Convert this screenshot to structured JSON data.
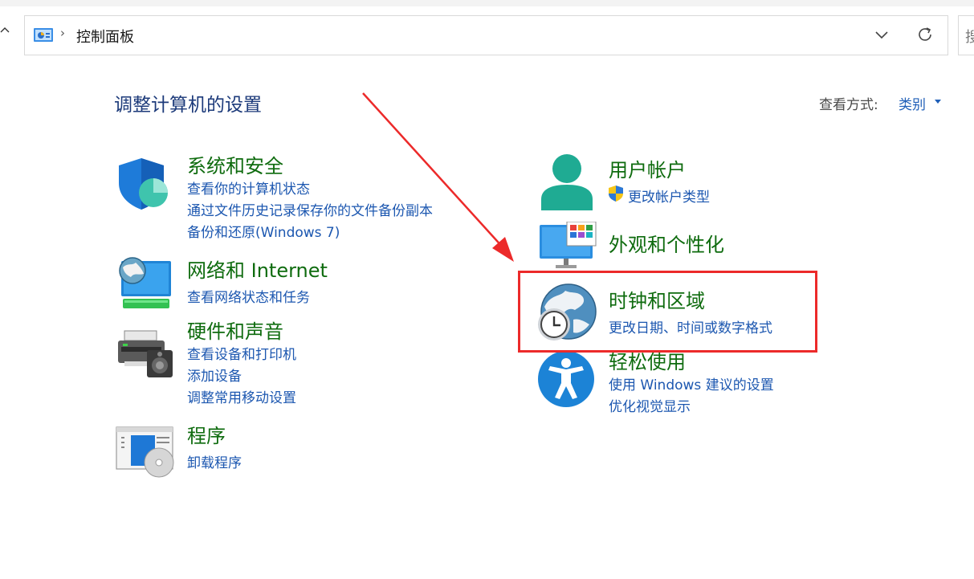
{
  "address_bar": {
    "path_text": "控制面板",
    "search_placeholder": "搜"
  },
  "page": {
    "title": "调整计算机的设置",
    "view_by_label": "查看方式:",
    "view_by_value": "类别"
  },
  "categories_left": [
    {
      "title": "系统和安全",
      "icon": "shield-icon",
      "links": [
        "查看你的计算机状态",
        "通过文件历史记录保存你的文件备份副本",
        "备份和还原(Windows 7)"
      ]
    },
    {
      "title": "网络和 Internet",
      "icon": "network-globe-icon",
      "links": [
        "查看网络状态和任务"
      ]
    },
    {
      "title": "硬件和声音",
      "icon": "printer-speaker-icon",
      "links": [
        "查看设备和打印机",
        "添加设备",
        "调整常用移动设置"
      ]
    },
    {
      "title": "程序",
      "icon": "programs-disc-icon",
      "links": [
        "卸载程序"
      ]
    }
  ],
  "categories_right": [
    {
      "title": "用户帐户",
      "icon": "user-icon",
      "links": [
        "更改帐户类型"
      ]
    },
    {
      "title": "外观和个性化",
      "icon": "monitor-personalize-icon",
      "links": []
    },
    {
      "title": "时钟和区域",
      "icon": "globe-clock-icon",
      "links": [
        "更改日期、时间或数字格式"
      ]
    },
    {
      "title": "轻松使用",
      "icon": "accessibility-icon",
      "links": [
        "使用 Windows 建议的设置",
        "优化视觉显示"
      ]
    }
  ],
  "annotation": {
    "highlight_color": "#ec2a2a"
  },
  "colors": {
    "title_green": "#0e6b0e",
    "link_blue": "#1c57b0",
    "heading_navy": "#1c3a7a"
  }
}
